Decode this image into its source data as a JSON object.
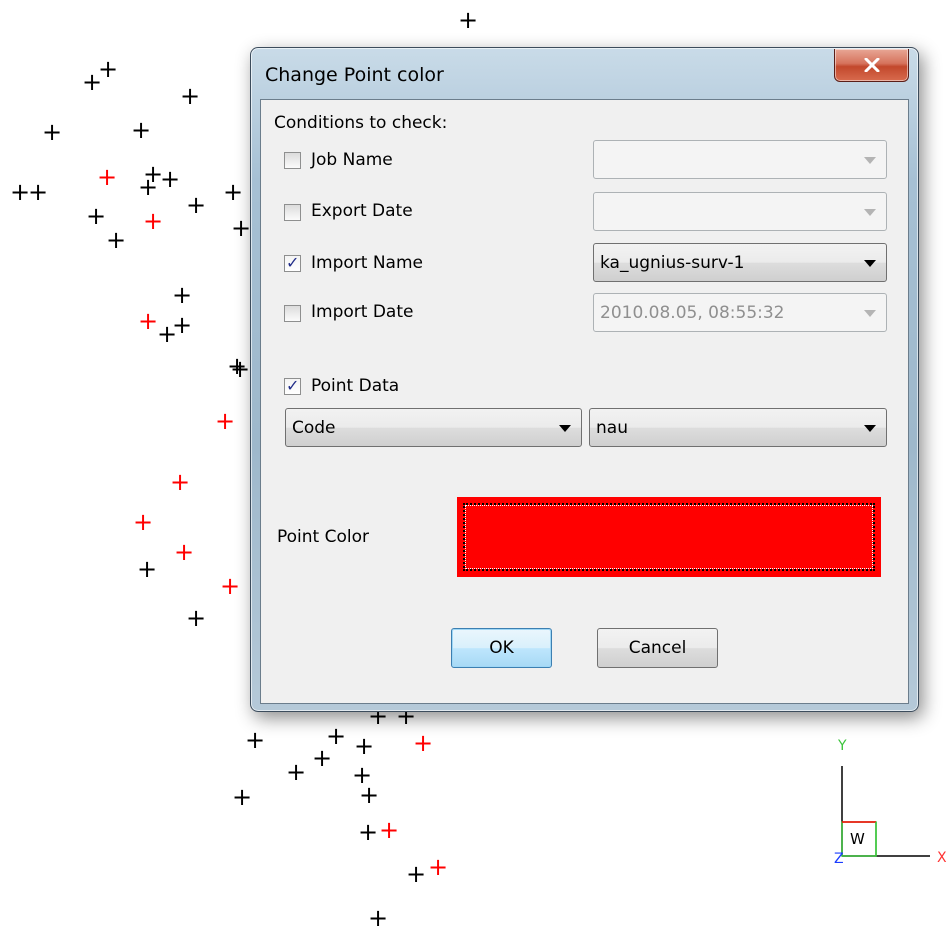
{
  "window": {
    "title": "Change Point color",
    "close_label": "x"
  },
  "conditions": {
    "heading": "Conditions to check:",
    "rows": [
      {
        "label": "Job Name",
        "checked": false,
        "value": "",
        "enabled": false
      },
      {
        "label": "Export Date",
        "checked": false,
        "value": "",
        "enabled": false
      },
      {
        "label": "Import Name",
        "checked": true,
        "value": "ka_ugnius-surv-1",
        "enabled": true
      },
      {
        "label": "Import Date",
        "checked": false,
        "value": "2010.08.05, 08:55:32",
        "enabled": false
      }
    ]
  },
  "point_data": {
    "label": "Point Data",
    "checked": true,
    "field_value": "Code",
    "match_value": "nau"
  },
  "point_color": {
    "label": "Point Color",
    "color": "#ff0000"
  },
  "buttons": {
    "ok": "OK",
    "cancel": "Cancel"
  },
  "axis": {
    "y_label": "Y",
    "x_label": "X",
    "z_label": "Z",
    "w_label": "W"
  },
  "colors": {
    "point_black": "#000000",
    "point_red": "#ff0000"
  }
}
